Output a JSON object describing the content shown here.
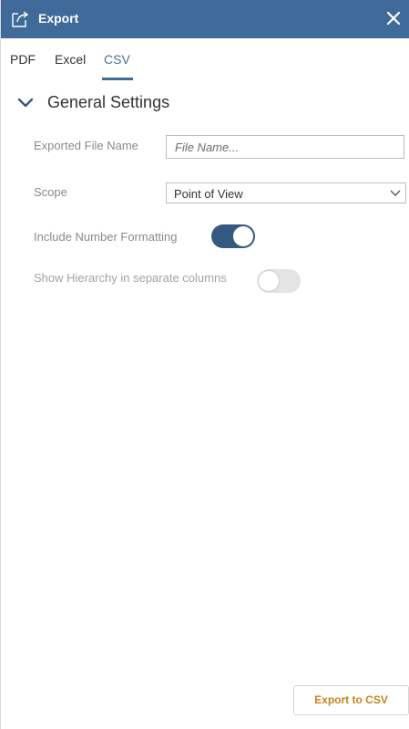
{
  "dialog": {
    "title": "Export",
    "title_icon": "export-icon",
    "close_icon": "close-icon"
  },
  "tabs": [
    {
      "label": "PDF",
      "active": false
    },
    {
      "label": "Excel",
      "active": false
    },
    {
      "label": "CSV",
      "active": true
    }
  ],
  "section": {
    "title": "General Settings",
    "expanded": true,
    "icon": "chevron-down-icon"
  },
  "fields": {
    "file_name": {
      "label": "Exported File Name",
      "value": "",
      "placeholder": "File Name..."
    },
    "scope": {
      "label": "Scope",
      "value": "Point of View",
      "icon": "chevron-down-icon"
    },
    "number_formatting": {
      "label": "Include Number Formatting",
      "on": true
    },
    "show_hierarchy": {
      "label": "Show Hierarchy in separate columns",
      "on": false
    }
  },
  "footer": {
    "export_label": "Export to CSV"
  },
  "colors": {
    "header_bg": "#3f6a99",
    "active_tab": "#4a6f9b",
    "toggle_on": "#36597f",
    "toggle_off": "#e4e4e4",
    "export_text": "#c6851a"
  }
}
